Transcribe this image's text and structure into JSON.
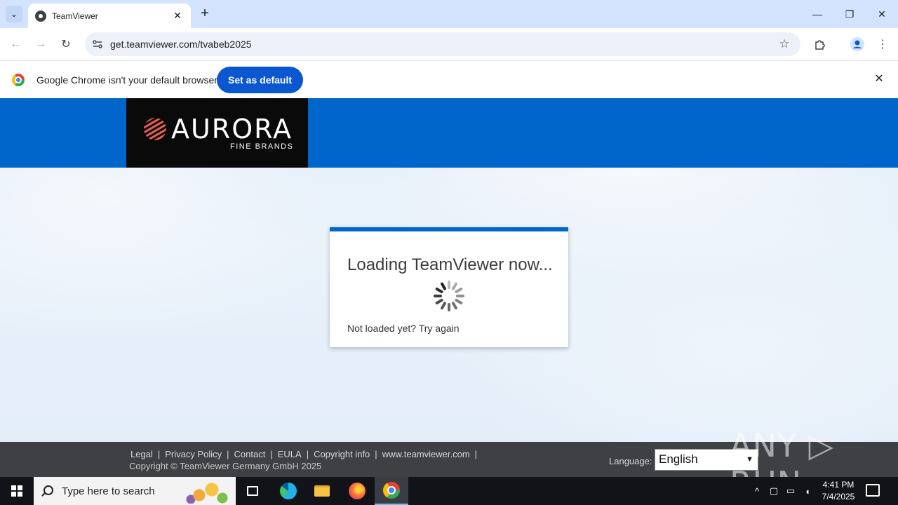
{
  "browser": {
    "tab_title": "TeamViewer",
    "new_tab_symbol": "+",
    "tab_close_symbol": "✕",
    "url": "get.teamviewer.com/tvabeb2025",
    "window_controls": {
      "minimize": "—",
      "maximize": "❐",
      "close": "✕"
    },
    "icons": {
      "back": "←",
      "forward": "→",
      "reload": "↻",
      "star": "☆",
      "extensions": "⧉",
      "menu": "⋮"
    }
  },
  "infobar": {
    "message": "Google Chrome isn't your default browser",
    "button_label": "Set as default",
    "close_symbol": "✕"
  },
  "brand": {
    "name": "AURORA",
    "sub": "FINE BRANDS"
  },
  "loader": {
    "title": "Loading TeamViewer now...",
    "retry_prefix": "Not loaded yet? ",
    "retry_link": "Try again"
  },
  "footer": {
    "links": [
      "Legal",
      "Privacy Policy",
      "Contact",
      "EULA",
      "Copyright info",
      "www.teamviewer.com"
    ],
    "separator": "|",
    "copyright": "Copyright © TeamViewer Germany GmbH 2025",
    "language_label": "Language:",
    "language_value": "English",
    "watermark": "ANY ▷ RUN"
  },
  "taskbar": {
    "search_placeholder": "Type here to search",
    "time": "4:41 PM",
    "date": "7/4/2025"
  },
  "colors": {
    "banner": "#0066cc",
    "logo_bg": "#0a0a0a",
    "accent_button": "#0b57d0",
    "footer_bg": "#3e4044",
    "tabstrip": "#d3e3fd"
  }
}
